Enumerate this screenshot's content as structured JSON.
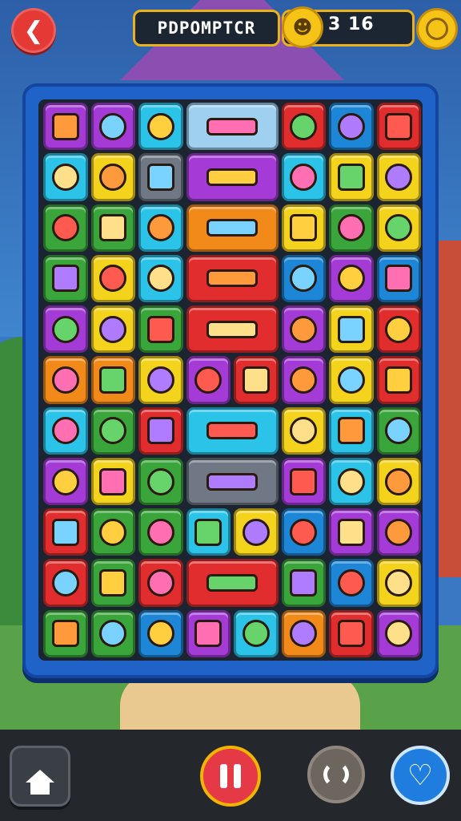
{
  "header": {
    "back_icon": "back-arrow-icon",
    "title": "PDPOMPTCR",
    "coin_icon": "coin-face-icon",
    "coin_value": "3 16",
    "settings_icon": "coin-settings-icon"
  },
  "colors": {
    "purple": "#a53bd6",
    "yellow": "#f4d31c",
    "cyan": "#2bc4e8",
    "red": "#e12d2d",
    "blue": "#1d86d6",
    "green": "#3aa53a",
    "orange": "#f28a1a",
    "gray": "#6f7884",
    "lightblue": "#9fd0f0",
    "frame": "#1f63c9",
    "pause": "#e53946"
  },
  "board": {
    "rows": 11,
    "cols": 8,
    "tiles": [
      {
        "r": 0,
        "c": 0,
        "w": 1,
        "color": "purple",
        "icon": "orange-blob-icon"
      },
      {
        "r": 0,
        "c": 1,
        "w": 1,
        "color": "purple",
        "icon": "face-with-hat-icon"
      },
      {
        "r": 0,
        "c": 2,
        "w": 1,
        "color": "cyan",
        "icon": "books-icon"
      },
      {
        "r": 0,
        "c": 3,
        "w": 2,
        "color": "lightblue",
        "icon": "wood-plank-icon"
      },
      {
        "r": 0,
        "c": 5,
        "w": 1,
        "color": "red",
        "icon": "leaf-icon"
      },
      {
        "r": 0,
        "c": 6,
        "w": 1,
        "color": "blue",
        "icon": "purple-egg-icon"
      },
      {
        "r": 0,
        "c": 7,
        "w": 1,
        "color": "red",
        "icon": "fox-face-icon"
      },
      {
        "r": 1,
        "c": 0,
        "w": 1,
        "color": "cyan",
        "icon": "blue-creature-icon"
      },
      {
        "r": 1,
        "c": 1,
        "w": 1,
        "color": "yellow",
        "icon": "cat-face-icon"
      },
      {
        "r": 1,
        "c": 2,
        "w": 1,
        "color": "gray",
        "icon": "boot-icon"
      },
      {
        "r": 1,
        "c": 3,
        "w": 2,
        "color": "purple",
        "icon": "candy-and-banana-icon"
      },
      {
        "r": 1,
        "c": 5,
        "w": 1,
        "color": "cyan",
        "icon": "pink-shoe-icon"
      },
      {
        "r": 1,
        "c": 6,
        "w": 1,
        "color": "yellow",
        "icon": "orange-face-icon"
      },
      {
        "r": 1,
        "c": 7,
        "w": 1,
        "color": "yellow",
        "icon": "toy-box-icon"
      },
      {
        "r": 2,
        "c": 0,
        "w": 1,
        "color": "green",
        "icon": "pink-bean-icon"
      },
      {
        "r": 2,
        "c": 1,
        "w": 1,
        "color": "green",
        "icon": "boy-face-icon"
      },
      {
        "r": 2,
        "c": 2,
        "w": 1,
        "color": "cyan",
        "icon": "pink-balloon-icon"
      },
      {
        "r": 2,
        "c": 3,
        "w": 2,
        "color": "orange",
        "icon": "red-sausage-icon"
      },
      {
        "r": 2,
        "c": 5,
        "w": 1,
        "color": "yellow",
        "icon": "crate-icon"
      },
      {
        "r": 2,
        "c": 6,
        "w": 1,
        "color": "green",
        "icon": "green-box-icon"
      },
      {
        "r": 2,
        "c": 7,
        "w": 1,
        "color": "yellow",
        "icon": "fox-face-icon"
      },
      {
        "r": 3,
        "c": 0,
        "w": 1,
        "color": "green",
        "icon": "spiky-burst-icon"
      },
      {
        "r": 3,
        "c": 1,
        "w": 1,
        "color": "yellow",
        "icon": "smiling-face-icon"
      },
      {
        "r": 3,
        "c": 2,
        "w": 1,
        "color": "cyan",
        "icon": "boy-face-icon"
      },
      {
        "r": 3,
        "c": 3,
        "w": 2,
        "color": "red",
        "icon": "ghost-and-hammer-icon"
      },
      {
        "r": 3,
        "c": 5,
        "w": 1,
        "color": "blue",
        "icon": "green-tooth-icon"
      },
      {
        "r": 3,
        "c": 6,
        "w": 1,
        "color": "purple",
        "icon": "crayon-icon"
      },
      {
        "r": 3,
        "c": 7,
        "w": 1,
        "color": "blue",
        "icon": "green-leaf-icon"
      },
      {
        "r": 4,
        "c": 0,
        "w": 1,
        "color": "purple",
        "icon": "leaf-icon"
      },
      {
        "r": 4,
        "c": 1,
        "w": 1,
        "color": "yellow",
        "icon": "girl-face-icon"
      },
      {
        "r": 4,
        "c": 2,
        "w": 1,
        "color": "green",
        "icon": "blue-ball-icon"
      },
      {
        "r": 4,
        "c": 3,
        "w": 2,
        "color": "red",
        "icon": "ball-and-brush-icon"
      },
      {
        "r": 4,
        "c": 5,
        "w": 1,
        "color": "purple",
        "icon": "sun-face-icon"
      },
      {
        "r": 4,
        "c": 6,
        "w": 1,
        "color": "yellow",
        "icon": "fox-face-icon"
      },
      {
        "r": 4,
        "c": 7,
        "w": 1,
        "color": "red",
        "icon": "ear-icon"
      },
      {
        "r": 5,
        "c": 0,
        "w": 1,
        "color": "orange",
        "icon": "smiling-face-icon"
      },
      {
        "r": 5,
        "c": 1,
        "w": 1,
        "color": "orange",
        "icon": "boy-face-icon"
      },
      {
        "r": 5,
        "c": 2,
        "w": 1,
        "color": "yellow",
        "icon": "gift-box-icon"
      },
      {
        "r": 5,
        "c": 3,
        "w": 1,
        "color": "purple",
        "icon": "pink-germ-icon"
      },
      {
        "r": 5,
        "c": 4,
        "w": 1,
        "color": "red",
        "icon": "mushroom-icon"
      },
      {
        "r": 5,
        "c": 5,
        "w": 1,
        "color": "purple",
        "icon": "crate-icon"
      },
      {
        "r": 5,
        "c": 6,
        "w": 1,
        "color": "yellow",
        "icon": "sun-face-icon"
      },
      {
        "r": 5,
        "c": 7,
        "w": 1,
        "color": "red",
        "icon": "ice-cream-icon"
      },
      {
        "r": 6,
        "c": 0,
        "w": 1,
        "color": "cyan",
        "icon": "girl-face-icon"
      },
      {
        "r": 6,
        "c": 1,
        "w": 1,
        "color": "green",
        "icon": "tin-can-icon"
      },
      {
        "r": 6,
        "c": 2,
        "w": 1,
        "color": "red",
        "icon": "splash-icon"
      },
      {
        "r": 6,
        "c": 3,
        "w": 2,
        "color": "cyan",
        "icon": "tree-and-clock-icon"
      },
      {
        "r": 6,
        "c": 5,
        "w": 1,
        "color": "yellow",
        "icon": "blob-face-icon"
      },
      {
        "r": 6,
        "c": 6,
        "w": 1,
        "color": "cyan",
        "icon": "globe-icon"
      },
      {
        "r": 6,
        "c": 7,
        "w": 1,
        "color": "green",
        "icon": "yellow-face-icon"
      },
      {
        "r": 7,
        "c": 0,
        "w": 1,
        "color": "purple",
        "icon": "girl-face-icon"
      },
      {
        "r": 7,
        "c": 1,
        "w": 1,
        "color": "yellow",
        "icon": "blue-blob-icon"
      },
      {
        "r": 7,
        "c": 2,
        "w": 1,
        "color": "green",
        "icon": "bowl-icon"
      },
      {
        "r": 7,
        "c": 3,
        "w": 2,
        "color": "gray",
        "icon": "gingerbread-and-crayon-icon"
      },
      {
        "r": 7,
        "c": 5,
        "w": 1,
        "color": "purple",
        "icon": "laughing-face-icon"
      },
      {
        "r": 7,
        "c": 6,
        "w": 1,
        "color": "cyan",
        "icon": "yellow-egg-icon"
      },
      {
        "r": 7,
        "c": 7,
        "w": 1,
        "color": "yellow",
        "icon": "bald-face-icon"
      },
      {
        "r": 8,
        "c": 0,
        "w": 1,
        "color": "red",
        "icon": "note-card-icon"
      },
      {
        "r": 8,
        "c": 1,
        "w": 1,
        "color": "green",
        "icon": "orange-fish-icon"
      },
      {
        "r": 8,
        "c": 2,
        "w": 1,
        "color": "green",
        "icon": "red-ball-icon"
      },
      {
        "r": 8,
        "c": 3,
        "w": 1,
        "color": "cyan",
        "icon": "green-tree-icon"
      },
      {
        "r": 8,
        "c": 4,
        "w": 1,
        "color": "yellow",
        "icon": "smiling-face-icon"
      },
      {
        "r": 8,
        "c": 5,
        "w": 1,
        "color": "blue",
        "icon": "green-blob-icon"
      },
      {
        "r": 8,
        "c": 6,
        "w": 1,
        "color": "purple",
        "icon": "green-ball-icon"
      },
      {
        "r": 8,
        "c": 7,
        "w": 1,
        "color": "purple",
        "icon": "sun-face-icon"
      },
      {
        "r": 9,
        "c": 0,
        "w": 1,
        "color": "red",
        "icon": "blue-cat-icon"
      },
      {
        "r": 9,
        "c": 1,
        "w": 1,
        "color": "green",
        "icon": "green-creature-icon"
      },
      {
        "r": 9,
        "c": 2,
        "w": 1,
        "color": "red",
        "icon": "jar-icon"
      },
      {
        "r": 9,
        "c": 3,
        "w": 2,
        "color": "red",
        "icon": "gem-and-hammer-icon"
      },
      {
        "r": 9,
        "c": 5,
        "w": 1,
        "color": "green",
        "icon": "blue-shell-icon"
      },
      {
        "r": 9,
        "c": 6,
        "w": 1,
        "color": "blue",
        "icon": "purple-splat-icon"
      },
      {
        "r": 9,
        "c": 7,
        "w": 1,
        "color": "yellow",
        "icon": "card-icon"
      },
      {
        "r": 10,
        "c": 0,
        "w": 1,
        "color": "green",
        "icon": "yellow-cat-icon"
      },
      {
        "r": 10,
        "c": 1,
        "w": 1,
        "color": "green",
        "icon": "robot-face-icon"
      },
      {
        "r": 10,
        "c": 2,
        "w": 1,
        "color": "blue",
        "icon": "blue-egg-icon"
      },
      {
        "r": 10,
        "c": 3,
        "w": 1,
        "color": "purple",
        "icon": "yellow-tree-icon"
      },
      {
        "r": 10,
        "c": 4,
        "w": 1,
        "color": "cyan",
        "icon": "yellow-sprout-icon"
      },
      {
        "r": 10,
        "c": 5,
        "w": 1,
        "color": "orange",
        "icon": "gray-cat-icon"
      },
      {
        "r": 10,
        "c": 6,
        "w": 1,
        "color": "red",
        "icon": "green-splat-icon"
      },
      {
        "r": 10,
        "c": 7,
        "w": 1,
        "color": "purple",
        "icon": "orange-face-icon"
      }
    ]
  },
  "footer": {
    "home_icon": "home-icon",
    "pause_icon": "pause-icon",
    "shuffle_icon": "shuffle-icon",
    "hint_icon": "heart-icon"
  }
}
